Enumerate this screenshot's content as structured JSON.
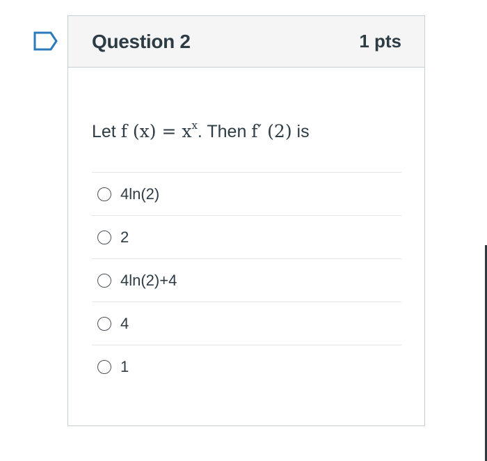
{
  "question": {
    "title": "Question 2",
    "points": "1 pts",
    "text_prefix": "Let ",
    "math_1": "f (x) = x",
    "math_1_sup": "x",
    "text_middle": ". Then ",
    "math_2": "f′ (2)",
    "text_suffix": " is"
  },
  "answers": [
    {
      "label": "4ln(2)"
    },
    {
      "label": "2"
    },
    {
      "label": "4ln(2)+4"
    },
    {
      "label": "4"
    },
    {
      "label": "1"
    }
  ],
  "colors": {
    "text": "#2d3b45",
    "border": "#c7cdd1",
    "header_bg": "#f5f5f5",
    "flag": "#2b7abc"
  },
  "icons": {
    "flag": "bookmark-flag-icon",
    "radio": "radio-unchecked-icon"
  }
}
